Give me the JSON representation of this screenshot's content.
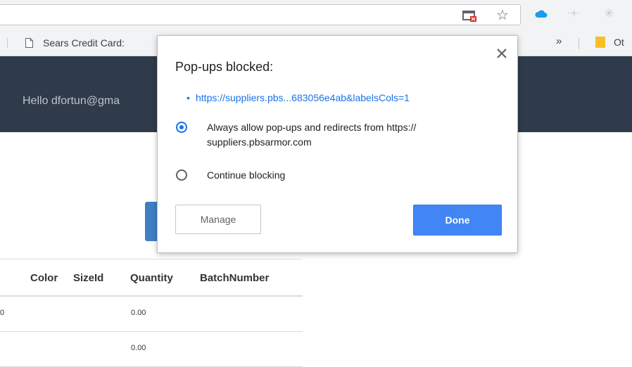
{
  "toolbar": {
    "popup_blocked_icon": "popup-blocked-icon",
    "bookmark_star_glyph": "☆",
    "extension_faded_glyph": "·+·",
    "extension_star_glyph": "✳"
  },
  "bookmarks": {
    "items": [
      {
        "label": "Sears Credit Card:",
        "icon": "page-icon"
      }
    ],
    "overflow_glyph": "»",
    "other_label": "Ot"
  },
  "header": {
    "greeting": "Hello dfortun@gma"
  },
  "table": {
    "columns": [
      "Color",
      "SizeId",
      "Quantity",
      "BatchNumber"
    ],
    "rows": [
      {
        "lead": "0",
        "quantity": "0.00"
      },
      {
        "lead": "",
        "quantity": "0.00"
      }
    ]
  },
  "popup": {
    "title": "Pop-ups blocked:",
    "link": "https://suppliers.pbs...683056e4ab&labelsCols=1",
    "options": [
      {
        "label_line1": "Always allow pop-ups and redirects from https://",
        "label_line2": "suppliers.pbsarmor.com",
        "selected": true
      },
      {
        "label_line1": "Continue blocking",
        "selected": false
      }
    ],
    "manage_label": "Manage",
    "done_label": "Done"
  },
  "colors": {
    "accent": "#1a73e8",
    "done_button": "#4285f4",
    "header_bg": "#2f3b4a"
  }
}
